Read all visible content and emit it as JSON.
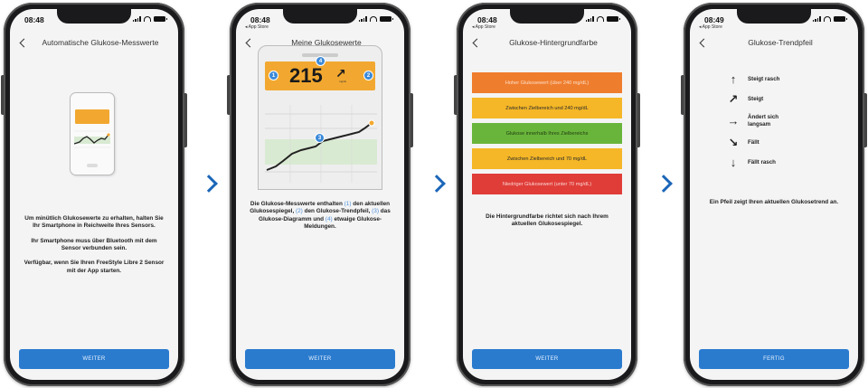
{
  "phones": [
    {
      "time": "08:48",
      "title": "Automatische Glukose-Messwerte",
      "paragraphs": [
        "Um minütlich Glukosewerte zu erhalten, halten Sie Ihr Smartphone in Reichweite Ihres Sensors.",
        "Ihr Smartphone muss über Bluetooth mit dem Sensor verbunden sein.",
        "Verfügbar, wenn Sie Ihren FreeStyle Libre 2 Sensor mit der App starten."
      ],
      "button": "WEITER"
    },
    {
      "time": "08:48",
      "back_label": "◂ App Store",
      "title": "Meine Glukosewerte",
      "reading_value": "215",
      "reading_unit": "mg/dL",
      "markers": [
        "1",
        "2",
        "3",
        "4"
      ],
      "desc": {
        "p1": "Die Glukose-Messwerte enthalten",
        "r1": "(1)",
        "p2": "den aktuellen Glukosespiegel,",
        "r2": "(2)",
        "p3": "den Glukose-Trendpfeil,",
        "r3": "(3)",
        "p4": "das Glukose-Diagramm und",
        "r4": "(4)",
        "p5": "etwaige Glukose-Meldungen."
      },
      "button": "WEITER"
    },
    {
      "time": "08:48",
      "back_label": "◂ App Store",
      "title": "Glukose-Hintergrundfarbe",
      "bands": [
        {
          "label": "Hoher Glukosewert (über 240 mg/dL)",
          "color": "#ef7d2e",
          "text_color": "#fce0c8"
        },
        {
          "label": "Zwischen Zielbereich und 240 mg/dL",
          "color": "#f5b727",
          "text_color": "#2a2a2a"
        },
        {
          "label": "Glukose innerhalb Ihres Zielbereichs",
          "color": "#69b53b",
          "text_color": "#1f3a10"
        },
        {
          "label": "Zwischen Zielbereich und 70 mg/dL",
          "color": "#f5b727",
          "text_color": "#2a2a2a"
        },
        {
          "label": "Niedriger Glukosewert (unter 70 mg/dL)",
          "color": "#e03d38",
          "text_color": "#fad4d2"
        }
      ],
      "desc": "Die Hintergrundfarbe richtet sich nach Ihrem aktuellen Glukosespiegel.",
      "button": "WEITER"
    },
    {
      "time": "08:49",
      "back_label": "◂ App Store",
      "title": "Glukose-Trendpfeil",
      "arrows": [
        {
          "icon": "arrow-up-icon",
          "glyph": "↑",
          "label": "Steigt rasch"
        },
        {
          "icon": "arrow-up-right-icon",
          "glyph": "↗",
          "label": "Steigt"
        },
        {
          "icon": "arrow-right-icon",
          "glyph": "→",
          "label": "Ändert sich langsam"
        },
        {
          "icon": "arrow-down-right-icon",
          "glyph": "↘",
          "label": "Fällt"
        },
        {
          "icon": "arrow-down-icon",
          "glyph": "↓",
          "label": "Fällt rasch"
        }
      ],
      "desc": "Ein Pfeil zeigt Ihren aktuellen Glukosetrend an.",
      "button": "FERTIG"
    }
  ],
  "colors": {
    "button_blue": "#2a7bce",
    "separator_blue": "#1b66b8",
    "orange": "#f2a830",
    "marker_blue": "#3a89d8"
  }
}
